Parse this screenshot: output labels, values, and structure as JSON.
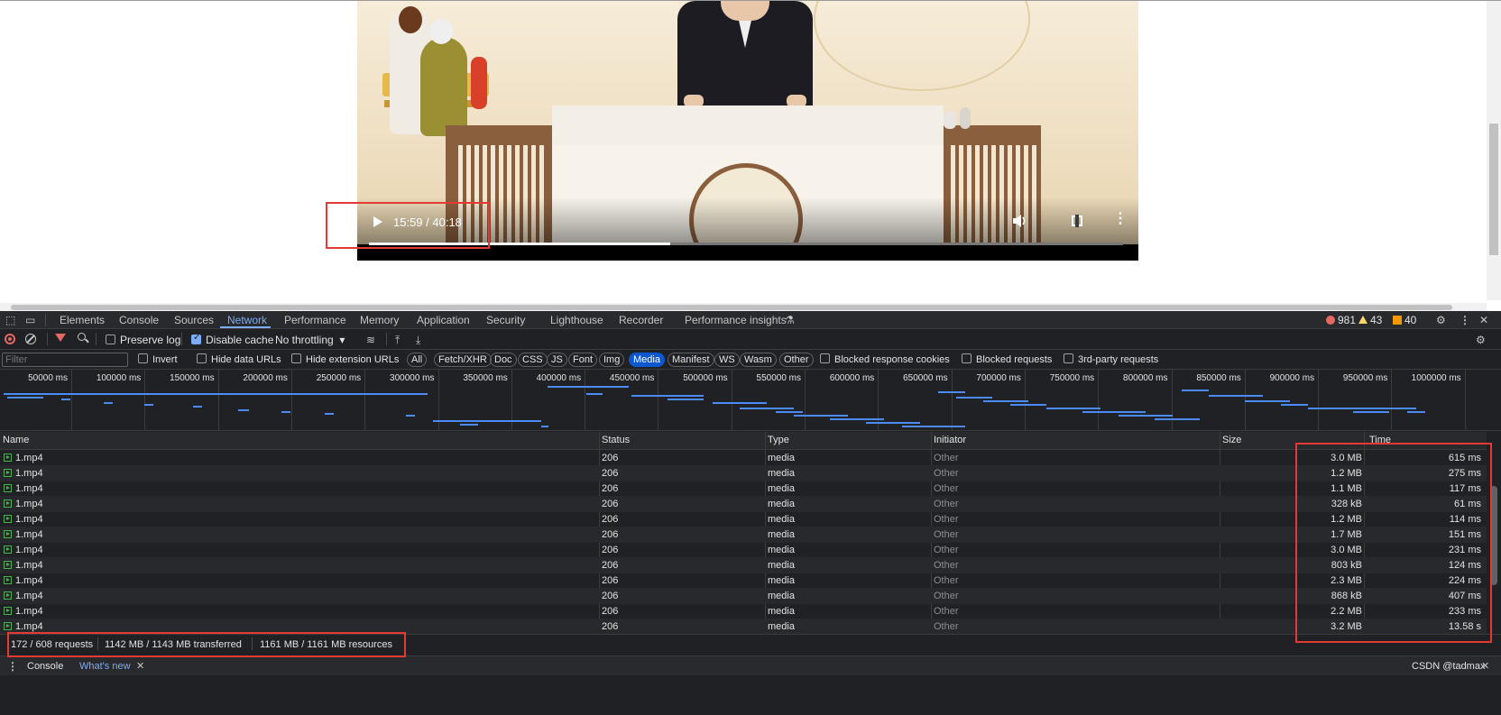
{
  "video": {
    "time": "15:59 / 40:18",
    "progress_fraction": 0.4
  },
  "devtools": {
    "tabs": [
      "Elements",
      "Console",
      "Sources",
      "Network",
      "Performance",
      "Memory",
      "Application",
      "Security",
      "Lighthouse",
      "Recorder",
      "Performance insights"
    ],
    "active_tab": "Network",
    "errors": "981",
    "warnings": "43",
    "issues": "40",
    "toolbar": {
      "preserve_log": "Preserve log",
      "disable_cache": "Disable cache",
      "throttling": "No throttling"
    },
    "filter": {
      "placeholder": "Filter",
      "invert": "Invert",
      "hide_data_urls": "Hide data URLs",
      "hide_extension_urls": "Hide extension URLs",
      "types": [
        "All",
        "Fetch/XHR",
        "Doc",
        "CSS",
        "JS",
        "Font",
        "Img",
        "Media",
        "Manifest",
        "WS",
        "Wasm",
        "Other"
      ],
      "active_type": "Media",
      "blocked_cookies": "Blocked response cookies",
      "blocked_requests": "Blocked requests",
      "third_party": "3rd-party requests"
    },
    "timeline_ticks": [
      "50000 ms",
      "100000 ms",
      "150000 ms",
      "200000 ms",
      "250000 ms",
      "300000 ms",
      "350000 ms",
      "400000 ms",
      "450000 ms",
      "500000 ms",
      "550000 ms",
      "600000 ms",
      "650000 ms",
      "700000 ms",
      "750000 ms",
      "800000 ms",
      "850000 ms",
      "900000 ms",
      "950000 ms",
      "1000000 ms"
    ],
    "columns": {
      "name": "Name",
      "status": "Status",
      "type": "Type",
      "initiator": "Initiator",
      "size": "Size",
      "time": "Time"
    },
    "rows": [
      {
        "name": "1.mp4",
        "status": "206",
        "type": "media",
        "initiator": "Other",
        "size": "3.0 MB",
        "time": "615 ms"
      },
      {
        "name": "1.mp4",
        "status": "206",
        "type": "media",
        "initiator": "Other",
        "size": "1.2 MB",
        "time": "275 ms"
      },
      {
        "name": "1.mp4",
        "status": "206",
        "type": "media",
        "initiator": "Other",
        "size": "1.1 MB",
        "time": "117 ms"
      },
      {
        "name": "1.mp4",
        "status": "206",
        "type": "media",
        "initiator": "Other",
        "size": "328 kB",
        "time": "61 ms"
      },
      {
        "name": "1.mp4",
        "status": "206",
        "type": "media",
        "initiator": "Other",
        "size": "1.2 MB",
        "time": "114 ms"
      },
      {
        "name": "1.mp4",
        "status": "206",
        "type": "media",
        "initiator": "Other",
        "size": "1.7 MB",
        "time": "151 ms"
      },
      {
        "name": "1.mp4",
        "status": "206",
        "type": "media",
        "initiator": "Other",
        "size": "3.0 MB",
        "time": "231 ms"
      },
      {
        "name": "1.mp4",
        "status": "206",
        "type": "media",
        "initiator": "Other",
        "size": "803 kB",
        "time": "124 ms"
      },
      {
        "name": "1.mp4",
        "status": "206",
        "type": "media",
        "initiator": "Other",
        "size": "2.3 MB",
        "time": "224 ms"
      },
      {
        "name": "1.mp4",
        "status": "206",
        "type": "media",
        "initiator": "Other",
        "size": "868 kB",
        "time": "407 ms"
      },
      {
        "name": "1.mp4",
        "status": "206",
        "type": "media",
        "initiator": "Other",
        "size": "2.2 MB",
        "time": "233 ms"
      },
      {
        "name": "1.mp4",
        "status": "206",
        "type": "media",
        "initiator": "Other",
        "size": "3.2 MB",
        "time": "13.58 s"
      }
    ],
    "summary": {
      "requests": "172 / 608 requests",
      "transferred": "1142 MB / 1143 MB transferred",
      "resources": "1161 MB / 1161 MB resources"
    },
    "drawer": {
      "console": "Console",
      "whats_new": "What's new"
    },
    "watermark": "CSDN @tadmax"
  }
}
